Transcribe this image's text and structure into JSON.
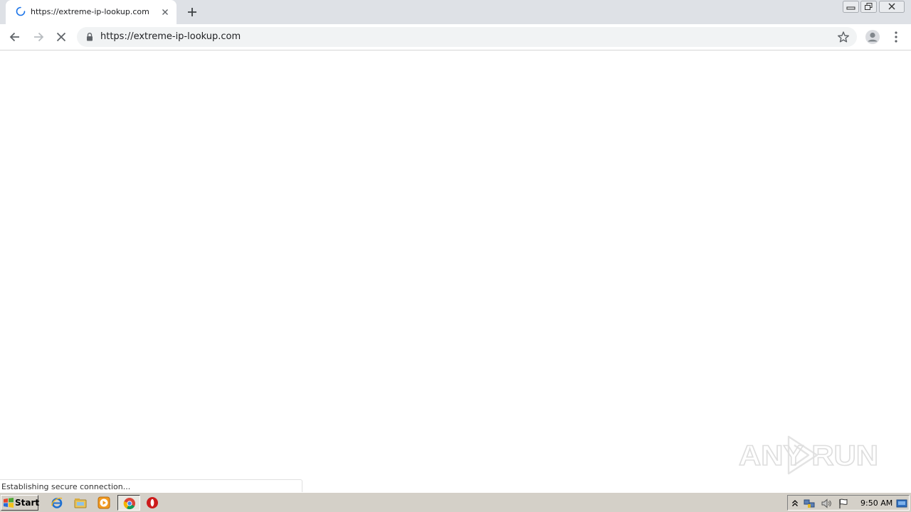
{
  "browser": {
    "tab": {
      "title": "https://extreme-ip-lookup.com"
    },
    "address_bar": {
      "url": "https://extreme-ip-lookup.com"
    },
    "status_text": "Establishing secure connection..."
  },
  "icons": {
    "tab_loading": "loading-spinner-icon",
    "tab_close": "close-icon",
    "new_tab": "plus-icon",
    "back": "arrow-left-icon",
    "forward": "arrow-right-icon",
    "stop": "stop-x-icon",
    "secure": "lock-icon",
    "bookmark": "star-icon",
    "profile": "person-icon",
    "menu": "kebab-menu-icon"
  },
  "watermark": {
    "text": "ANY RUN"
  },
  "taskbar": {
    "start_label": "Start",
    "clock": "9:50 AM",
    "pinned": [
      "internet-explorer-icon",
      "file-explorer-icon",
      "media-player-icon",
      "chrome-icon",
      "opera-icon"
    ],
    "tray": [
      "show-hidden-icon",
      "network-icon",
      "volume-icon",
      "action-center-flag-icon",
      "show-desktop-icon"
    ]
  },
  "colors": {
    "tabstrip": "#dee1e6",
    "omnibox": "#f1f3f4",
    "taskbar": "#d4d0c8",
    "text": "#202124"
  }
}
